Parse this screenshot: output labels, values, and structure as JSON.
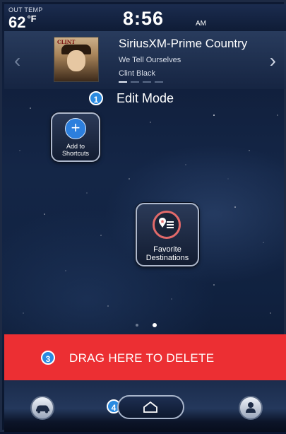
{
  "status_bar": {
    "out_temp_label": "OUT TEMP",
    "out_temp_value": "62",
    "out_temp_unit": "°F",
    "time": "8:56",
    "ampm": "AM"
  },
  "media": {
    "station": "SiriusXM-Prime Country",
    "song": "We Tell Ourselves",
    "artist": "Clint Black",
    "album_text": "CLINT",
    "prev_icon": "chevron-left-icon",
    "next_icon": "chevron-right-icon",
    "preset_pages": 4,
    "active_preset_page": 1
  },
  "edit_mode": {
    "badge": "1",
    "title": "Edit Mode"
  },
  "tiles": {
    "add_shortcut": {
      "label": "Add to Shortcuts",
      "icon": "plus-icon"
    },
    "favorite_destinations": {
      "label": "Favorite Destinations",
      "icon": "favorite-pin-list-icon"
    }
  },
  "page_indicator": {
    "pages": 2,
    "active": 2
  },
  "delete_bar": {
    "badge": "3",
    "text": "DRAG HERE TO DELETE"
  },
  "bottom_bar": {
    "home_badge": "4",
    "car_icon": "car-icon",
    "home_icon": "home-icon",
    "profile_icon": "profile-icon"
  },
  "colors": {
    "delete_red": "#ec2f33",
    "badge_blue": "#2a8ae0",
    "accent_blue": "#2c7fdd",
    "favorite_red": "#e26a6a"
  }
}
